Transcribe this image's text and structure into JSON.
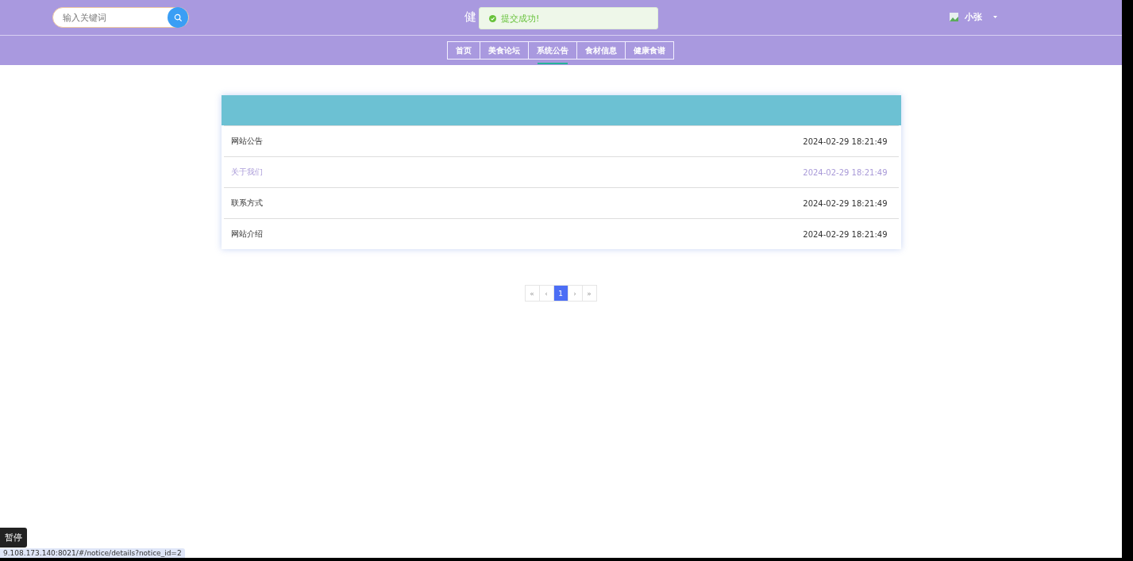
{
  "search": {
    "placeholder": "输入关键词"
  },
  "site_title": "健",
  "toast": {
    "message": "提交成功!"
  },
  "user": {
    "name": "小张"
  },
  "nav": [
    {
      "label": "首页",
      "selected": false
    },
    {
      "label": "美食论坛",
      "selected": false
    },
    {
      "label": "系统公告",
      "selected": true
    },
    {
      "label": "食材信息",
      "selected": false
    },
    {
      "label": "健康食谱",
      "selected": false
    }
  ],
  "notices": [
    {
      "title": "网站公告",
      "time": "2024-02-29 18:21:49",
      "highlighted": false
    },
    {
      "title": "关于我们",
      "time": "2024-02-29 18:21:49",
      "highlighted": true
    },
    {
      "title": "联系方式",
      "time": "2024-02-29 18:21:49",
      "highlighted": false
    },
    {
      "title": "网站介绍",
      "time": "2024-02-29 18:21:49",
      "highlighted": false
    }
  ],
  "pagination": [
    {
      "label": "«",
      "selected": false
    },
    {
      "label": "‹",
      "selected": false
    },
    {
      "label": "1",
      "selected": true
    },
    {
      "label": "›",
      "selected": false
    },
    {
      "label": "»",
      "selected": false
    }
  ],
  "tooltip": "暂停",
  "status_url": "9.108.173.140:8021/#/notice/details?notice_id=2"
}
